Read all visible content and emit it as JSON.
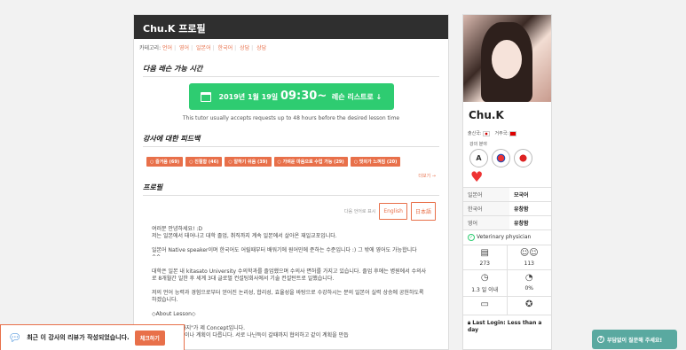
{
  "header": {
    "title": "Chu.K 프로필"
  },
  "categories": {
    "label": "카테고리:",
    "items": [
      "언어",
      "영어",
      "일본어",
      "한국어",
      "상담",
      "상담"
    ]
  },
  "next_lesson": {
    "heading": "다음 레슨 가능 시간",
    "date": "2019년 1월 19일",
    "time": "09:30",
    "tilde": "~",
    "list_label": "레슨 리스트로 ↓",
    "note": "This tutor usually accepts requests up to 48 hours before the desired lesson time"
  },
  "feedback": {
    "heading": "강사에 대한 피드백",
    "tags": [
      "○ 즐거움 (69)",
      "○ 친절함 (46)",
      "○ 알하기 쉬움 (39)",
      "○ 가벼운 마음으로 수업 가능 (29)",
      "○ 멋의가 느껴짐 (20)"
    ],
    "more": "더보기 →"
  },
  "profile": {
    "heading": "프로필",
    "lang_label": "다음 언어로 표시",
    "lang_english": "English",
    "lang_japanese": "日本語",
    "paragraphs": [
      "여러분 안녕하세요! :D\n저는 일본에서 태어나고 대학 졸업, 취직까지 계속 일본에서 살아온 재일교포입니다.",
      "일본어 Native speaker이며 한국어도 어릴때부터 배워기에 원어민에 준하는 수준입니다 :) 그 밖에 영어도 가능합니다 ^^",
      "대학은 일본 내 kitasato University 수의학과를 졸업했으며 수의사 면허를 가지고 있습니다. 졸업 후에는 병원에서 수의사로 8개월간 일한 후 세계 3대 글로벌 컨설팅회사에서 기술 컨설턴트로 일했습니다.",
      "저의 언어 능력과 경험으로부터 얻어진 논리성, 합리성, 효율성을 바탕으로 수강하시는 분의 일본어 실력 상승에 공헌하도록하겠습니다.",
      "◇About Lesson◇",
      "비지니스레벨까지\"가 제 Concept입니다.\nbest의 학습법이나 계획이 다릅니다. 서로 나닌득이 갈때까지 협의하고 같이 계획을 만듭"
    ]
  },
  "tutor": {
    "name": "Chu.K",
    "origin_label": "출신국:",
    "residence_label": "거주국:",
    "lang_section_label": "강의 분야",
    "cup_a": "A",
    "languages": [
      {
        "name": "일본어",
        "level": "모국어"
      },
      {
        "name": "한국어",
        "level": "유창함"
      },
      {
        "name": "영어",
        "level": "유창함"
      }
    ],
    "specialty": "Veterinary physician",
    "stats": {
      "lessons": "273",
      "students": "113",
      "response": "1.3 일 이내",
      "cancel": "0%"
    },
    "last_login": "Last Login: Less than a day"
  },
  "toast": {
    "message": "최근 이 강사의 리뷰가 작성되었습니다.",
    "button": "체크하기"
  },
  "help": {
    "label": "부담없이 질문해 주세요!"
  },
  "colors": {
    "accent": "#e8704a",
    "green": "#2ecc71",
    "header": "#2f2f2f",
    "help": "#5aa9a0"
  }
}
